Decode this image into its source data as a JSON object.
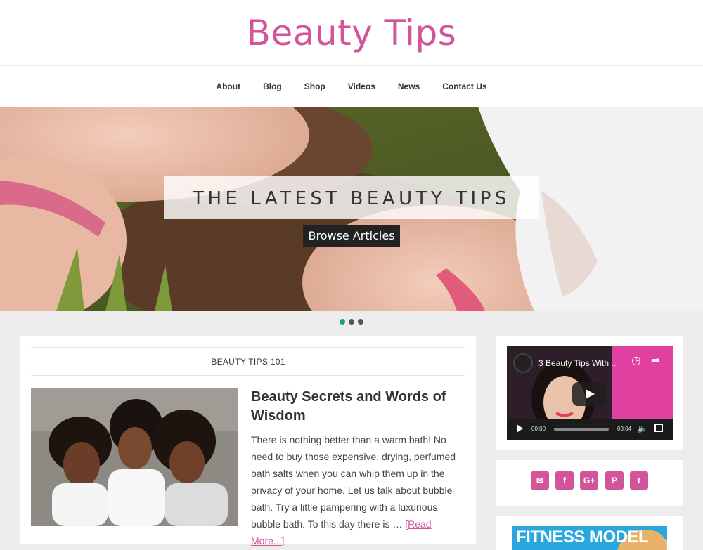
{
  "site": {
    "title": "Beauty Tips"
  },
  "nav": {
    "items": [
      "About",
      "Blog",
      "Shop",
      "Videos",
      "News",
      "Contact Us"
    ]
  },
  "hero": {
    "title": "THE LATEST BEAUTY TIPS",
    "button": "Browse Articles",
    "slides": 3,
    "active_slide": 1
  },
  "section": {
    "heading": "BEAUTY TIPS 101"
  },
  "post": {
    "title": "Beauty Secrets and Words of Wisdom",
    "excerpt": "There is nothing better than a warm bath! No need to buy those expensive, drying, perfumed bath salts when you can whip them up in the privacy of your home. Let us talk about bubble bath. Try a little pampering with a luxurious bubble bath. To this day there is …",
    "read_more": "[Read More...]"
  },
  "video": {
    "title": "3 Beauty Tips With ...",
    "current_time": "00:00",
    "duration": "03:04"
  },
  "social": {
    "icons": [
      "email-icon",
      "facebook-icon",
      "google-plus-icon",
      "pinterest-icon",
      "twitter-icon"
    ],
    "glyphs": [
      "✉",
      "f",
      "G+",
      "P",
      "t"
    ]
  },
  "ad": {
    "text": "FITNESS MODEL SKINCARE"
  },
  "colors": {
    "brand": "#d2549a",
    "active_dot": "#1aa56a"
  }
}
